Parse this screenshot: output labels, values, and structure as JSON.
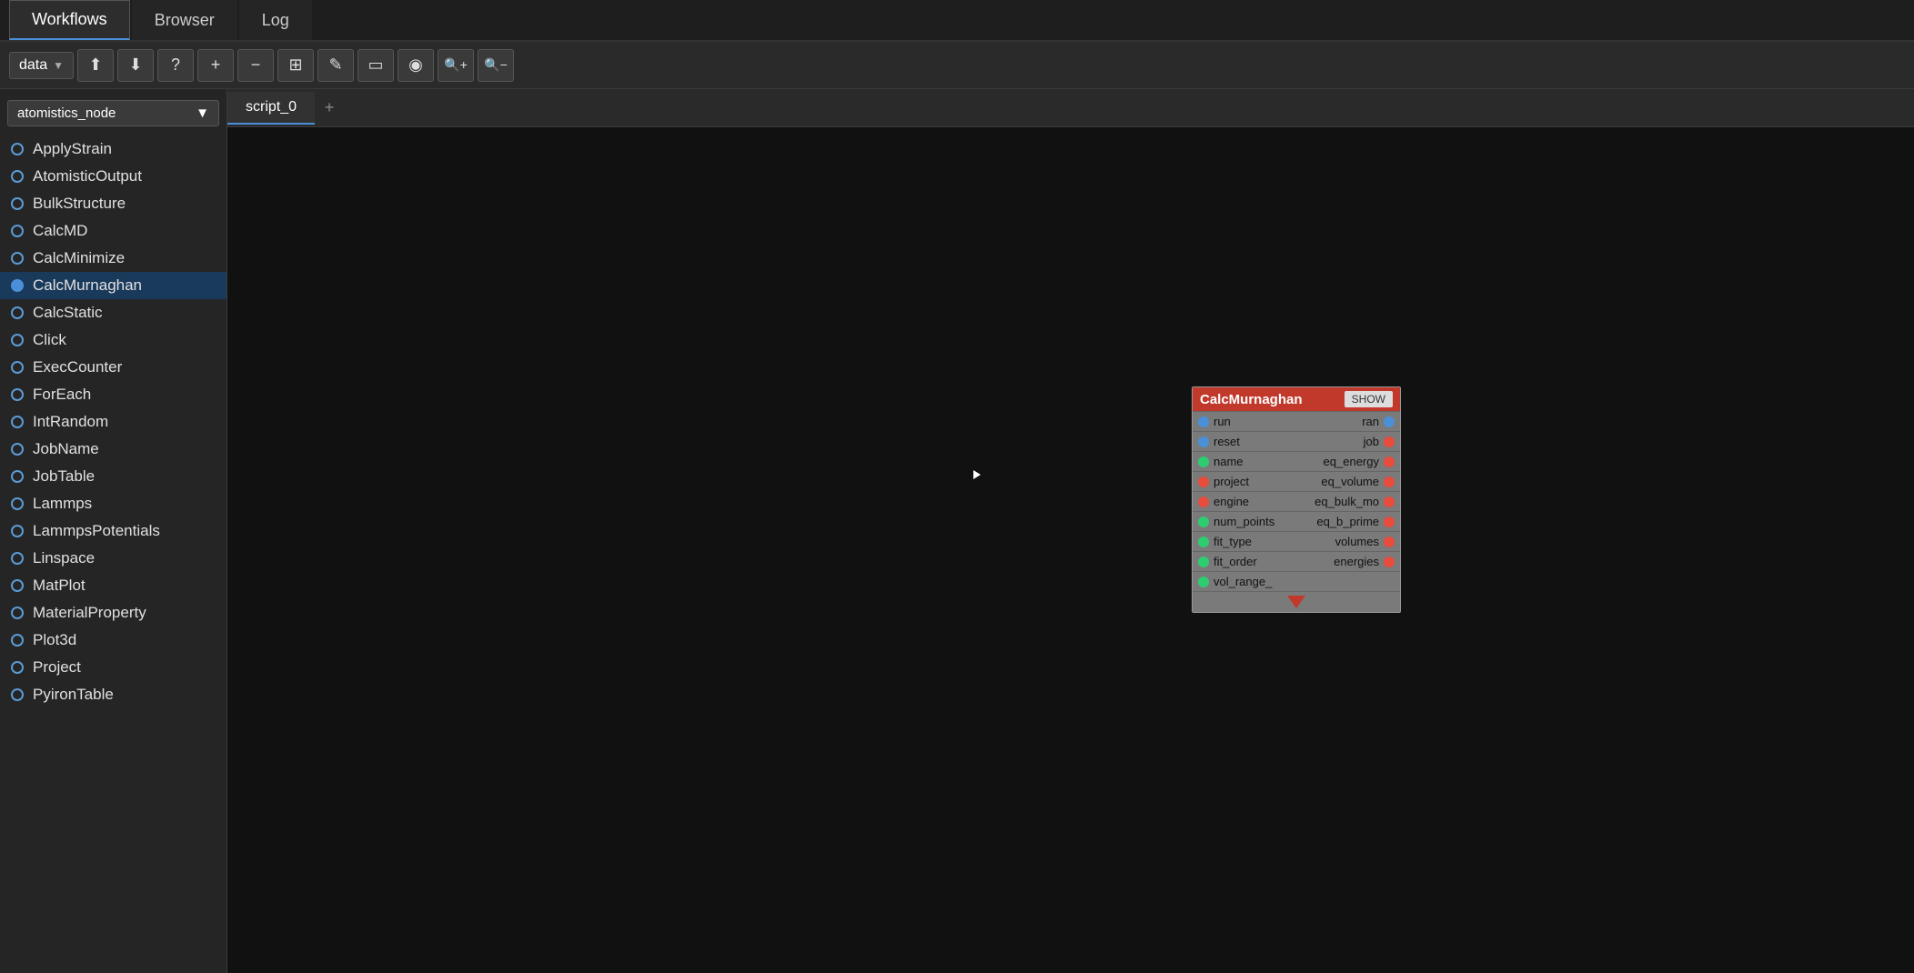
{
  "tabs": [
    {
      "id": "workflows",
      "label": "Workflows",
      "active": true
    },
    {
      "id": "browser",
      "label": "Browser",
      "active": false
    },
    {
      "id": "log",
      "label": "Log",
      "active": false
    }
  ],
  "toolbar": {
    "dropdown": {
      "label": "data",
      "value": "data"
    },
    "buttons": [
      {
        "id": "upload",
        "icon": "⬆",
        "tooltip": "Upload"
      },
      {
        "id": "download",
        "icon": "⬇",
        "tooltip": "Download"
      },
      {
        "id": "help",
        "icon": "?",
        "tooltip": "Help"
      },
      {
        "id": "add",
        "icon": "+",
        "tooltip": "Add"
      },
      {
        "id": "remove",
        "icon": "−",
        "tooltip": "Remove"
      },
      {
        "id": "expand",
        "icon": "⊞",
        "tooltip": "Expand"
      },
      {
        "id": "edit",
        "icon": "✎",
        "tooltip": "Edit"
      },
      {
        "id": "collapse",
        "icon": "▭",
        "tooltip": "Collapse"
      },
      {
        "id": "pin",
        "icon": "📍",
        "tooltip": "Pin"
      },
      {
        "id": "zoom-in",
        "icon": "🔍+",
        "tooltip": "Zoom In"
      },
      {
        "id": "zoom-out",
        "icon": "🔍−",
        "tooltip": "Zoom Out"
      }
    ]
  },
  "sidebar": {
    "dropdown": {
      "label": "atomistics_node",
      "value": "atomistics_node"
    },
    "items": [
      {
        "id": "apply-strain",
        "label": "ApplyStrain",
        "selected": false
      },
      {
        "id": "atomistic-output",
        "label": "AtomisticOutput",
        "selected": false
      },
      {
        "id": "bulk-structure",
        "label": "BulkStructure",
        "selected": false
      },
      {
        "id": "calc-md",
        "label": "CalcMD",
        "selected": false
      },
      {
        "id": "calc-minimize",
        "label": "CalcMinimize",
        "selected": false
      },
      {
        "id": "calc-murnaghan",
        "label": "CalcMurnaghan",
        "selected": true
      },
      {
        "id": "calc-static",
        "label": "CalcStatic",
        "selected": false
      },
      {
        "id": "click",
        "label": "Click",
        "selected": false
      },
      {
        "id": "exec-counter",
        "label": "ExecCounter",
        "selected": false
      },
      {
        "id": "for-each",
        "label": "ForEach",
        "selected": false
      },
      {
        "id": "int-random",
        "label": "IntRandom",
        "selected": false
      },
      {
        "id": "job-name",
        "label": "JobName",
        "selected": false
      },
      {
        "id": "job-table",
        "label": "JobTable",
        "selected": false
      },
      {
        "id": "lammps",
        "label": "Lammps",
        "selected": false
      },
      {
        "id": "lammps-potentials",
        "label": "LammpsPotentials",
        "selected": false
      },
      {
        "id": "linspace",
        "label": "Linspace",
        "selected": false
      },
      {
        "id": "mat-plot",
        "label": "MatPlot",
        "selected": false
      },
      {
        "id": "material-property",
        "label": "MaterialProperty",
        "selected": false
      },
      {
        "id": "plot3d",
        "label": "Plot3d",
        "selected": false
      },
      {
        "id": "project",
        "label": "Project",
        "selected": false
      },
      {
        "id": "pyiron-table",
        "label": "PyironTable",
        "selected": false
      }
    ]
  },
  "canvas": {
    "active_tab": "script_0",
    "tabs": [
      {
        "id": "script-0",
        "label": "script_0",
        "active": true
      }
    ],
    "add_tab_label": "+",
    "node": {
      "title": "CalcMurnaghan",
      "show_btn": "SHOW",
      "left": "1060",
      "top": "285",
      "ports": [
        {
          "left_dot": "blue",
          "left_label": "run",
          "right_label": "ran",
          "right_dot": "blue"
        },
        {
          "left_dot": "blue",
          "left_label": "reset",
          "right_label": "job",
          "right_dot": "red"
        },
        {
          "left_dot": "green",
          "left_label": "name",
          "right_label": "eq_energy",
          "right_dot": "red"
        },
        {
          "left_dot": "red",
          "left_label": "project",
          "right_label": "eq_volume",
          "right_dot": "red"
        },
        {
          "left_dot": "red",
          "left_label": "engine",
          "right_label": "eq_bulk_mo",
          "right_dot": "red"
        },
        {
          "left_dot": "green",
          "left_label": "num_points",
          "right_label": "eq_b_prime",
          "right_dot": "red"
        },
        {
          "left_dot": "green",
          "left_label": "fit_type",
          "right_label": "volumes",
          "right_dot": "red"
        },
        {
          "left_dot": "green",
          "left_label": "fit_order",
          "right_label": "energies",
          "right_dot": "red"
        },
        {
          "left_dot": "green",
          "left_label": "vol_range_",
          "right_label": "",
          "right_dot": null
        }
      ]
    }
  },
  "colors": {
    "accent": "#4a90d9",
    "dot_blue": "#4a90d9",
    "dot_red": "#e74c3c",
    "dot_green": "#2ecc71",
    "node_header": "#c0392b",
    "selected_bg": "#1a3a5c"
  }
}
